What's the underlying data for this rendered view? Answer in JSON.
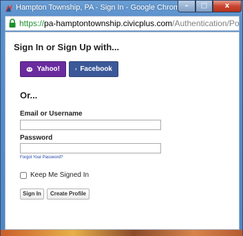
{
  "window": {
    "title": "Hampton Township, PA - Sign In - Google Chrome",
    "controls": {
      "minimize": "–",
      "maximize": "□",
      "close": "x"
    }
  },
  "address_bar": {
    "protocol": "https://",
    "host": "pa-hamptontownship.civicplus.com",
    "path": "/Authentication/Popup?re"
  },
  "signin": {
    "heading": "Sign In or Sign Up with...",
    "social": [
      {
        "label": "Yahoo!",
        "icon": "yahoo-icon",
        "color": "#6a2b9e"
      },
      {
        "label": "Facebook",
        "icon": "facebook-icon",
        "color": "#3b5998"
      }
    ],
    "or_text": "Or...",
    "email_label": "Email or Username",
    "email_value": "",
    "password_label": "Password",
    "password_value": "",
    "forgot_link": "Forgot Your Password?",
    "keep_signed_in": "Keep Me Signed In",
    "keep_signed_in_checked": false,
    "signin_button": "Sign In",
    "create_profile_button": "Create Profile"
  }
}
